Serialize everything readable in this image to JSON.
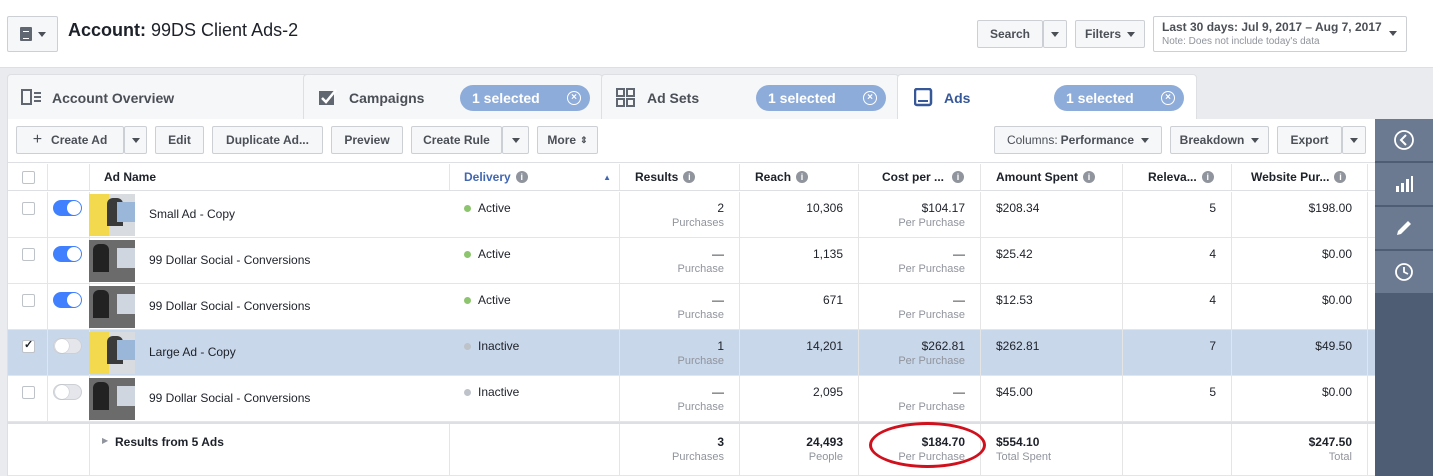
{
  "header": {
    "account_label": "Account:",
    "account_name": "99DS Client Ads-2",
    "search_label": "Search",
    "filters_label": "Filters",
    "date_range": "Last 30 days: Jul 9, 2017 – Aug 7, 2017",
    "date_note": "Note: Does not include today's data"
  },
  "tabs": [
    {
      "label": "Account Overview",
      "icon": "account-overview-icon"
    },
    {
      "label": "Campaigns",
      "icon": "checkbox-icon",
      "selected": "1 selected"
    },
    {
      "label": "Ad Sets",
      "icon": "grid-icon",
      "selected": "1 selected"
    },
    {
      "label": "Ads",
      "icon": "ad-icon",
      "selected": "1 selected"
    }
  ],
  "toolbar": {
    "create_ad": "Create Ad",
    "edit": "Edit",
    "duplicate": "Duplicate Ad...",
    "preview": "Preview",
    "create_rule": "Create Rule",
    "more": "More",
    "columns_label": "Columns:",
    "columns_value": "Performance",
    "breakdown": "Breakdown",
    "export": "Export"
  },
  "columns": [
    "Ad Name",
    "Delivery",
    "Results",
    "Reach",
    "Cost per ...",
    "Amount Spent",
    "Releva...",
    "Website Pur..."
  ],
  "rows": [
    {
      "name": "Small Ad - Copy",
      "delivery": "Active",
      "results": "2",
      "results_sub": "Purchases",
      "reach": "10,306",
      "cost": "$104.17",
      "cost_sub": "Per Purchase",
      "spent": "$208.34",
      "relevance": "5",
      "website": "$198.00",
      "on": true,
      "checked": false
    },
    {
      "name": "99 Dollar Social - Conversions",
      "delivery": "Active",
      "results": "—",
      "results_sub": "Purchase",
      "reach": "1,135",
      "cost": "—",
      "cost_sub": "Per Purchase",
      "spent": "$25.42",
      "relevance": "4",
      "website": "$0.00",
      "on": true,
      "checked": false
    },
    {
      "name": "99 Dollar Social - Conversions",
      "delivery": "Active",
      "results": "—",
      "results_sub": "Purchase",
      "reach": "671",
      "cost": "—",
      "cost_sub": "Per Purchase",
      "spent": "$12.53",
      "relevance": "4",
      "website": "$0.00",
      "on": true,
      "checked": false
    },
    {
      "name": "Large Ad - Copy",
      "delivery": "Inactive",
      "results": "1",
      "results_sub": "Purchase",
      "reach": "14,201",
      "cost": "$262.81",
      "cost_sub": "Per Purchase",
      "spent": "$262.81",
      "relevance": "7",
      "website": "$49.50",
      "on": false,
      "checked": true
    },
    {
      "name": "99 Dollar Social - Conversions",
      "delivery": "Inactive",
      "results": "—",
      "results_sub": "Purchase",
      "reach": "2,095",
      "cost": "—",
      "cost_sub": "Per Purchase",
      "spent": "$45.00",
      "relevance": "5",
      "website": "$0.00",
      "on": false,
      "checked": false
    }
  ],
  "totals": {
    "label": "Results from 5 Ads",
    "results": "3",
    "results_sub": "Purchases",
    "reach": "24,493",
    "reach_sub": "People",
    "cost": "$184.70",
    "cost_sub": "Per Purchase",
    "spent": "$554.10",
    "spent_sub": "Total Spent",
    "website": "$247.50",
    "website_sub": "Total"
  },
  "rail": [
    "collapse-icon",
    "chart-icon",
    "pencil-icon",
    "clock-icon"
  ],
  "colors": {
    "accent": "#4080ff",
    "selected_row": "#c9d7ea",
    "highlight_oval": "#d0101c",
    "rail": "#4e5d73"
  }
}
